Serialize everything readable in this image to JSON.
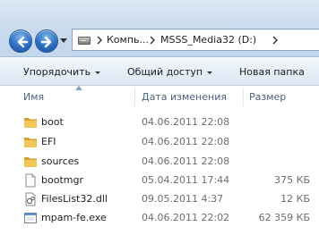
{
  "navigation": {
    "breadcrumb": [
      {
        "label": "Компь..."
      },
      {
        "label": "MSSS_Media32 (D:)"
      }
    ]
  },
  "toolbar": {
    "organize_label": "Упорядочить",
    "share_label": "Общий доступ",
    "new_folder_label": "Новая папка"
  },
  "columns": {
    "name": "Имя",
    "date": "Дата изменения",
    "size": "Размер"
  },
  "files": [
    {
      "name": "boot",
      "date": "04.06.2011 22:08",
      "size": "",
      "icon": "folder-icon"
    },
    {
      "name": "EFI",
      "date": "04.06.2011 22:08",
      "size": "",
      "icon": "folder-icon"
    },
    {
      "name": "sources",
      "date": "04.06.2011 22:08",
      "size": "",
      "icon": "folder-icon"
    },
    {
      "name": "bootmgr",
      "date": "05.04.2011 17:44",
      "size": "375 КБ",
      "icon": "file-icon"
    },
    {
      "name": "FilesList32.dll",
      "date": "09.05.2011 4:37",
      "size": "12 КБ",
      "icon": "dll-file-icon"
    },
    {
      "name": "mpam-fe.exe",
      "date": "04.06.2011 22:02",
      "size": "62 359 КБ",
      "icon": "exe-file-icon"
    }
  ],
  "colors": {
    "accent": "#2d6fc2",
    "folder": "#e8b84a",
    "header_text": "#4c607a"
  }
}
